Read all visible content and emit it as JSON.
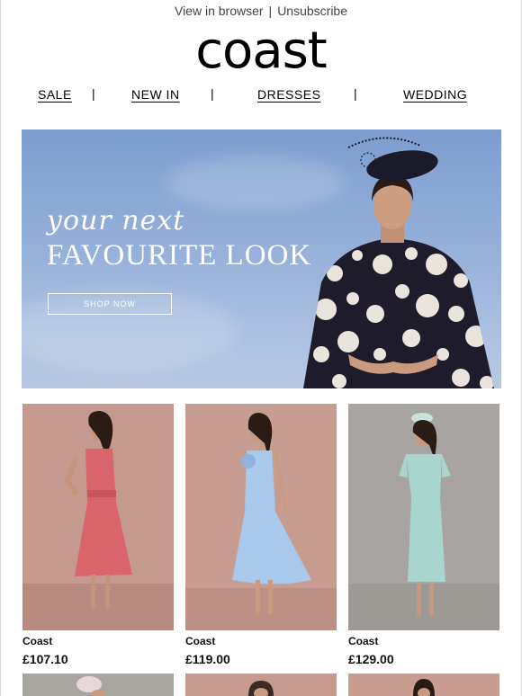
{
  "header": {
    "view_in_browser": "View in browser",
    "separator": "|",
    "unsubscribe": "Unsubscribe",
    "logo": "coast"
  },
  "nav": {
    "items": [
      {
        "label": "SALE"
      },
      {
        "label": "NEW IN"
      },
      {
        "label": "DRESSES"
      },
      {
        "label": "WEDDING"
      }
    ],
    "divider": "|"
  },
  "hero": {
    "script_text": "your next",
    "headline": "FAVOURITE LOOK",
    "cta": "SHOP NOW"
  },
  "products": [
    {
      "brand": "Coast",
      "price": "£107.10",
      "dress_color": "#d9646b",
      "backdrop": "#c6998e"
    },
    {
      "brand": "Coast",
      "price": "£119.00",
      "dress_color": "#a9c9ec",
      "backdrop": "#c79d91"
    },
    {
      "brand": "Coast",
      "price": "£129.00",
      "dress_color": "#a8d6cf",
      "backdrop": "#a7a4a1"
    }
  ],
  "colors": {
    "text": "#111111",
    "hero_sky": "#8fa9d6",
    "polka_dark": "#1e1c2b"
  }
}
